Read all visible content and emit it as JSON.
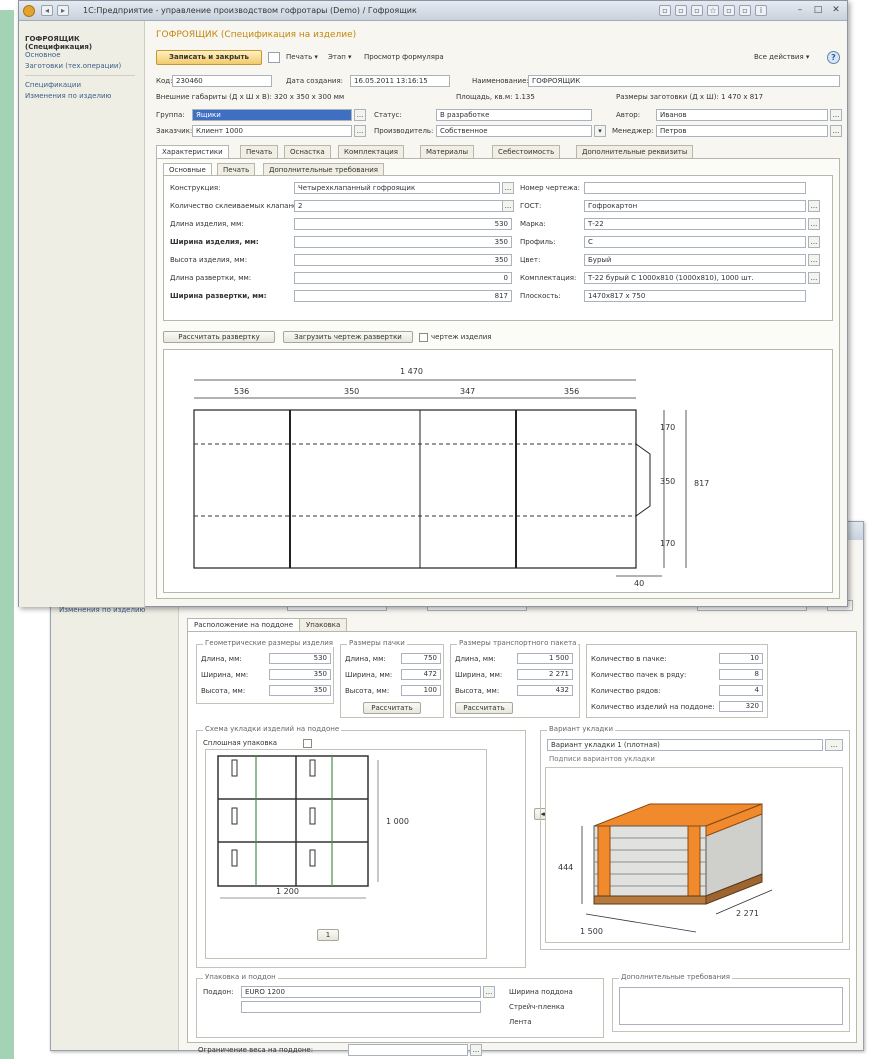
{
  "window": {
    "title": "1С:Предприятие - управление производством гофротары (Demo) / Гофроящик",
    "back_title": ""
  },
  "sidebar": {
    "header": "ГОФРОЯЩИК (Спецификация)",
    "links": [
      "Основное",
      "Заготовки (тех.операции)"
    ],
    "links2": [
      "Спецификации",
      "Изменения по изделию"
    ],
    "back_link": "Изменения по изделию"
  },
  "doc": {
    "title": "ГОФРОЯЩИК (Спецификация на изделие)",
    "save_button": "Записать и закрыть",
    "menu_links": [
      "Печать ▾",
      "Этап ▾",
      "Просмотр формуляра"
    ],
    "all_actions": "Все действия ▾",
    "help": "?"
  },
  "header_fields": {
    "code_label": "Код:",
    "code_value": "230460",
    "date_label": "Дата создания:",
    "date_value": "16.05.2011 13:16:15",
    "name_label": "Наименование:",
    "name_value": "ГОФРОЯЩИК",
    "summary_left": "Внешние габариты (Д х Ш х В): 320 х 350 х 300 мм",
    "summary_mid": "Площадь, кв.м: 1.135",
    "summary_right": "Размеры заготовки (Д х Ш): 1 470 х 817"
  },
  "row2": {
    "group_label": "Группа:",
    "group_value": "Ящики",
    "status_label": "Статус:",
    "status_value": "В разработке",
    "author_label": "Автор:",
    "author_value": "Иванов"
  },
  "row3": {
    "customer_label": "Заказчик:",
    "customer_value": "Клиент 1000",
    "producer_label": "Производитель:",
    "producer_value": "Собственное",
    "manager_label": "Менеджер:",
    "manager_value": "Петров"
  },
  "tabs": [
    "Характеристики",
    "Печать",
    "Оснастка",
    "Комплектация",
    "Материалы",
    "Себестоимость",
    "Дополнительные реквизиты"
  ],
  "inner_tabs": [
    "Основные",
    "Печать",
    "Дополнительные требования"
  ],
  "props": {
    "left": [
      {
        "label": "Конструкция:",
        "value": "Четырехклапанный гофроящик",
        "bold": false
      },
      {
        "label": "Количество склеиваемых клапанов:",
        "value": "2",
        "bold": false
      },
      {
        "label": "Длина изделия, мм:",
        "value": "530",
        "bold": false
      },
      {
        "label": "Ширина изделия, мм:",
        "value": "350",
        "bold": true
      },
      {
        "label": "Высота изделия, мм:",
        "value": "350",
        "bold": false
      },
      {
        "label": "Длина развертки, мм:",
        "value": "0",
        "bold": false
      },
      {
        "label": "Ширина развертки, мм:",
        "value": "817",
        "bold": true
      }
    ],
    "right": [
      {
        "label": "Номер чертежа:",
        "value": ""
      },
      {
        "label": "ГОСТ:",
        "value": "Гофрокартон"
      },
      {
        "label": "Марка:",
        "value": "Т-22"
      },
      {
        "label": "Профиль:",
        "value": "С"
      },
      {
        "label": "Цвет:",
        "value": "Бурый"
      },
      {
        "label": "Комплектация:",
        "value": "Т-22 бурый С 1000х810 (1000х810), 1000 шт."
      },
      {
        "label": "Плоскость:",
        "value": "1470х817 х 750"
      }
    ]
  },
  "actions": {
    "calc_button": "Рассчитать развертку",
    "load_button": "Загрузить чертеж развертки",
    "check_label": "чертеж изделия"
  },
  "drawing": {
    "total": "1 470",
    "seg1": "536",
    "seg2": "350",
    "seg3": "347",
    "seg4": "356",
    "h1": "170",
    "h2": "350",
    "h3": "170",
    "htotal": "817",
    "flap": "40"
  },
  "back": {
    "sub_tabs": [
      "Расположение на поддоне",
      "Упаковка"
    ],
    "group1": {
      "title": "Геометрические размеры изделия",
      "rows": [
        {
          "label": "Длина, мм:",
          "value": "530"
        },
        {
          "label": "Ширина, мм:",
          "value": "350"
        },
        {
          "label": "Высота, мм:",
          "value": "350"
        }
      ]
    },
    "group2": {
      "title": "Размеры пачки",
      "rows": [
        {
          "label": "Длина, мм:",
          "value": "750"
        },
        {
          "label": "Ширина, мм:",
          "value": "472"
        },
        {
          "label": "Высота, мм:",
          "value": "100"
        }
      ],
      "button": "Рассчитать"
    },
    "group3": {
      "title": "Размеры транспортного пакета",
      "rows": [
        {
          "label": "Длина, мм:",
          "value": "1 500"
        },
        {
          "label": "Ширина, мм:",
          "value": "2 271"
        },
        {
          "label": "Высота, мм:",
          "value": "432"
        }
      ],
      "button": "Рассчитать"
    },
    "group4": {
      "rows": [
        {
          "label": "Количество в пачке:",
          "value": "10"
        },
        {
          "label": "Количество пачек в ряду:",
          "value": "8"
        },
        {
          "label": "Количество рядов:",
          "value": "4"
        },
        {
          "label": "Количество изделий на поддоне:",
          "value": "320"
        }
      ]
    },
    "layout_group": {
      "title": "Схема укладки изделий на поддоне",
      "checkbox_label": "Сплошная упаковка",
      "dim_right": "1 000",
      "dim_bottom": "1 200",
      "stepper": "1"
    },
    "variant_group": {
      "title": "Вариант укладки",
      "select_value": "Вариант укладки 1 (плотная)",
      "sub_label": "Подписи вариантов укладки",
      "dim_h": "444",
      "dim_w": "1 500",
      "dim_d": "2 271"
    },
    "pallet_group": {
      "title": "Упаковка и поддон",
      "pallet_label": "Поддон:",
      "pallet_value": "EURO 1200",
      "check1": "Ширина поддона",
      "check2": "Стрейч-пленка",
      "check3": "Лента",
      "bottom_label": "Ограничение веса на поддоне:"
    },
    "extra_group": {
      "title": "Дополнительные требования"
    }
  }
}
